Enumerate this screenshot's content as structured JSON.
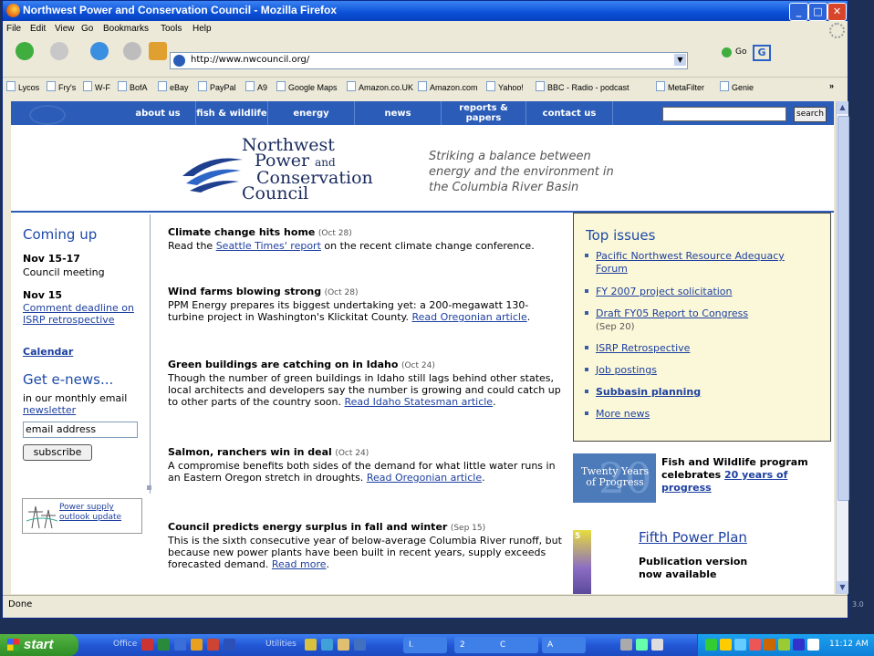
{
  "window": {
    "title": "Northwest Power and Conservation Council - Mozilla Firefox",
    "min": "_",
    "max": "□",
    "close": "✕"
  },
  "menu": [
    "File",
    "Edit",
    "View",
    "Go",
    "Bookmarks",
    "Tools",
    "Help"
  ],
  "url": "http://www.nwcouncil.org/",
  "go_label": "Go",
  "bookmarks": [
    "Lycos",
    "Fry's",
    "W-F",
    "BofA",
    "eBay",
    "PayPal",
    "A9",
    "Google Maps",
    "Amazon.co.UK",
    "Amazon.com",
    "Yahoo!",
    "BBC - Radio - podcast",
    "MetaFilter",
    "Genie",
    "»"
  ],
  "sitenav": {
    "items": [
      "about us",
      "fish & wildlife",
      "energy",
      "news",
      "reports & papers",
      "contact us"
    ],
    "search_label": "search"
  },
  "logo": {
    "line1": "Northwest",
    "line2": "Power",
    "line2b": "and",
    "line3": "Conservation",
    "line4": "Council"
  },
  "tagline": "Striking a balance between energy and the environment in the Columbia River Basin",
  "left": {
    "coming_up": "Coming up",
    "ev1_date": "Nov 15-17",
    "ev1_text": "Council meeting",
    "ev2_date": "Nov 15",
    "ev2_link": "Comment deadline on ISRP retrospective",
    "calendar": "Calendar",
    "enews": "Get e-news...",
    "enews_text": "in our monthly email",
    "enews_link": "newsletter",
    "email_value": "email address",
    "subscribe": "subscribe",
    "supply_link": "Power supply outlook update"
  },
  "news": [
    {
      "title": "Climate change hits home",
      "date": "(Oct 28)",
      "pre": "Read the ",
      "link": "Seattle Times' report",
      "post": " on the  recent climate change conference."
    },
    {
      "title": "Wind farms blowing strong",
      "date": "(Oct 28)",
      "pre": "PPM Energy prepares its biggest undertaking yet: a 200-megawatt 130-turbine project in Washington's Klickitat County. ",
      "link": "Read Oregonian article",
      "post": "."
    },
    {
      "title": "Green buildings are catching on in Idaho",
      "date": "(Oct 24)",
      "pre": "Though the number of green buildings in Idaho still lags behind other states, local architects and developers say the number is growing and could catch up to other parts of the country soon. ",
      "link": "Read Idaho Statesman article",
      "post": "."
    },
    {
      "title": "Salmon, ranchers win in deal",
      "date": "(Oct 24)",
      "pre": "A compromise benefits both sides of the demand for what little water runs in an Eastern Oregon stretch in droughts. ",
      "link": "Read Oregonian article",
      "post": "."
    },
    {
      "title": "Council predicts energy surplus in fall and winter",
      "date": "(Sep 15)",
      "pre": "This is the sixth consecutive year of below-average Columbia River runoff, but because new power plants have been built in recent years, supply exceeds forecasted demand. ",
      "link": "Read more",
      "post": "."
    }
  ],
  "top_issues": {
    "heading": "Top issues",
    "items": [
      "Pacific Northwest Resource Adequacy Forum",
      "FY 2007 project solicitation",
      "Draft FY05 Report to Congress",
      "ISRP Retrospective",
      "Job postings",
      "Subbasin planning",
      "More news"
    ],
    "draft_date": "(Sep 20)"
  },
  "twenty": {
    "img_line1": "Twenty Years",
    "img_line2": "of Progress",
    "pre": "Fish and Wildlife program celebrates ",
    "link": "20 years of progress"
  },
  "fpp": {
    "title": "Fifth Power Plan",
    "sub": "Publication version now available",
    "thumb_num": "5"
  },
  "status": "Done",
  "side_num": "3.0",
  "taskbar": {
    "start": "start",
    "office": "Office",
    "utilities": "Utilities",
    "tasks": [
      "I.",
      "2",
      "C",
      "A"
    ],
    "clock": "11:12 AM"
  }
}
